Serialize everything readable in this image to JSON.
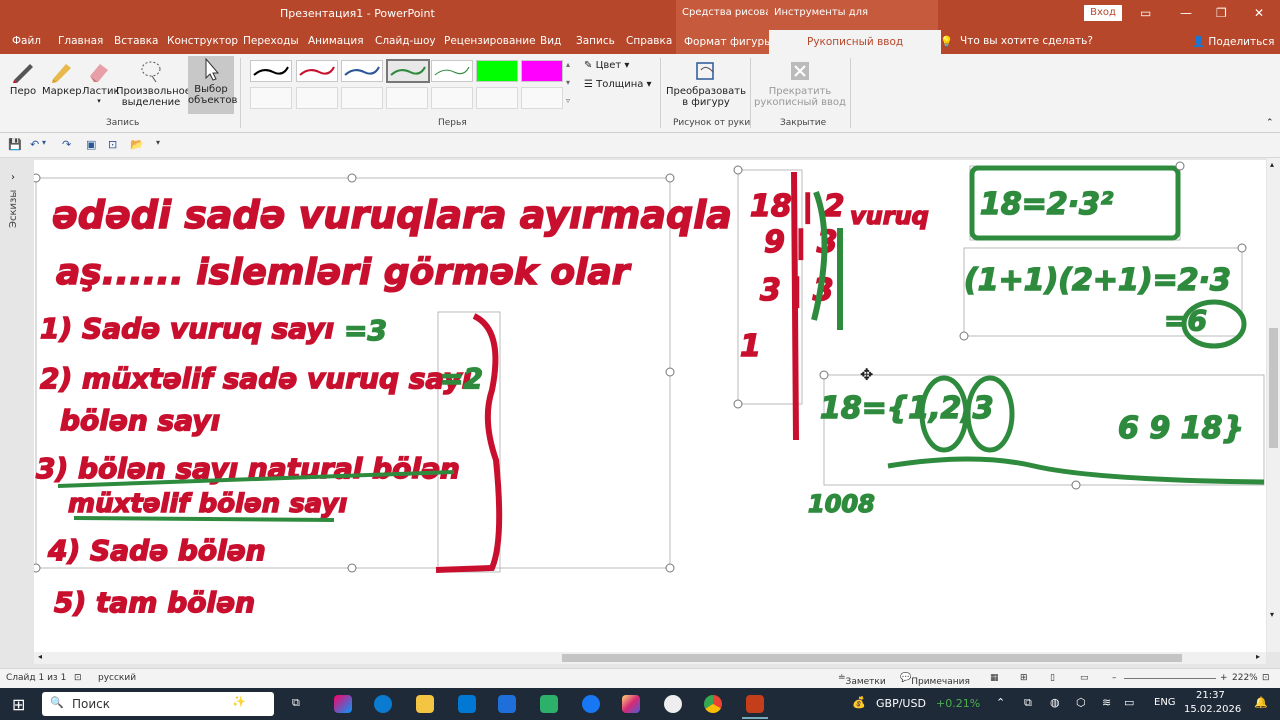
{
  "titlebar": {
    "title": "Презентация1  -  PowerPoint",
    "context_drawing": "Средства рисования",
    "context_ink": "Инструменты для рукописного ввода",
    "login": "Вход"
  },
  "menu": [
    "Файл",
    "Главная",
    "Вставка",
    "Конструктор",
    "Переходы",
    "Анимация",
    "Слайд-шоу",
    "Рецензирование",
    "Вид",
    "Запись",
    "Справка"
  ],
  "menu_context": "Формат фигуры",
  "menu_active": "Рукописный ввод",
  "tell_me": "Что вы хотите сделать?",
  "share": "Поделиться",
  "ribbon": {
    "pen": "Перо",
    "marker": "Маркер",
    "eraser": "Ластик",
    "lasso_1": "Произвольное",
    "lasso_2": "выделение",
    "select_1": "Выбор",
    "select_2": "объектов",
    "group_record": "Запись",
    "group_pens": "Перья",
    "color": "Цвет",
    "thickness": "Толщина",
    "convert_1": "Преобразовать",
    "convert_2": "в фигуру",
    "group_drawing": "Рисунок от руки",
    "stop_1": "Прекратить",
    "stop_2": "рукописный ввод",
    "group_close": "Закрытие"
  },
  "pens": [
    {
      "color": "#000000"
    },
    {
      "color": "#c8102e"
    },
    {
      "color": "#2b5797"
    },
    {
      "color": "#2e8b3d"
    },
    {
      "color": "#2e8b3d"
    },
    {
      "color": "#00ff00"
    },
    {
      "color": "#ff00ff"
    }
  ],
  "left_pane": "Эскизы",
  "slide_ink_red": [
    "ədədi sadə vuruqlara ayırmaqla",
    "aş......  islemləri görmək olar",
    "1) Sadə vuruq sayı",
    "2) müxtəlif sadə vuruq sayı",
    "bölən sayı",
    "3) bölən sayı natural bölən",
    "müxtəlif bölən sayı",
    "4) Sadə bölən",
    "5) tam bölən",
    "18 | 2",
    "9 | 3",
    "3 | 3",
    "1",
    "vuruq"
  ],
  "slide_ink_green": [
    "=3",
    "=2",
    "18=2·3²",
    "(1+1)(2+1)=2·3",
    "=6",
    "18={1,2,3",
    "6 9 18}",
    "1008"
  ],
  "status": {
    "slide": "Слайд 1 из 1",
    "lang": "русский",
    "notes": "Заметки",
    "comments": "Примечания",
    "zoom": "222%"
  },
  "taskbar": {
    "search": "Поиск",
    "ticker": "GBP/USD",
    "change": "+0.21%",
    "lang": "ENG",
    "time": "21:37",
    "date": "15.02.2026"
  }
}
